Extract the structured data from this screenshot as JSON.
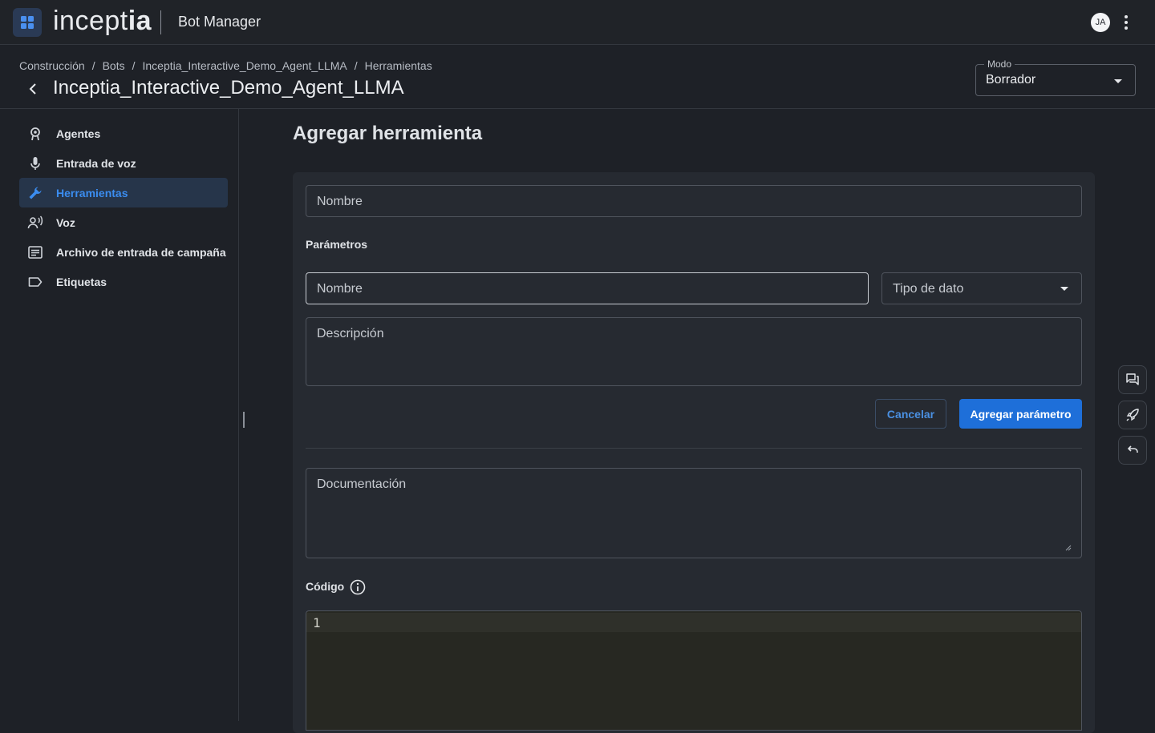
{
  "topbar": {
    "logo_thin": "incept",
    "logo_bold": "ia",
    "app_name": "Bot Manager",
    "avatar_initials": "JA"
  },
  "header": {
    "breadcrumb": [
      "Construcción",
      "Bots",
      "Inceptia_Interactive_Demo_Agent_LLMA",
      "Herramientas"
    ],
    "breadcrumb_sep": "/",
    "title": "Inceptia_Interactive_Demo_Agent_LLMA",
    "mode": {
      "label": "Modo",
      "value": "Borrador"
    }
  },
  "sidebar": {
    "items": [
      {
        "label": "Agentes",
        "icon": "agent-icon",
        "active": false
      },
      {
        "label": "Entrada de voz",
        "icon": "microphone-icon",
        "active": false
      },
      {
        "label": "Herramientas",
        "icon": "wrench-icon",
        "active": true
      },
      {
        "label": "Voz",
        "icon": "voice-icon",
        "active": false
      },
      {
        "label": "Archivo de entrada de campaña",
        "icon": "file-list-icon",
        "active": false
      },
      {
        "label": "Etiquetas",
        "icon": "label-icon",
        "active": false
      }
    ]
  },
  "main": {
    "title": "Agregar herramienta",
    "name_placeholder": "Nombre",
    "params_label": "Parámetros",
    "param_name_placeholder": "Nombre",
    "param_type_placeholder": "Tipo de dato",
    "description_placeholder": "Descripción",
    "cancel_label": "Cancelar",
    "add_param_label": "Agregar parámetro",
    "documentation_placeholder": "Documentación",
    "code_label": "Código",
    "code_line_number": "1"
  },
  "colors": {
    "accent": "#1e6fd9",
    "active_text": "#3b8df0",
    "background": "#1e2127",
    "card": "#262a31"
  }
}
